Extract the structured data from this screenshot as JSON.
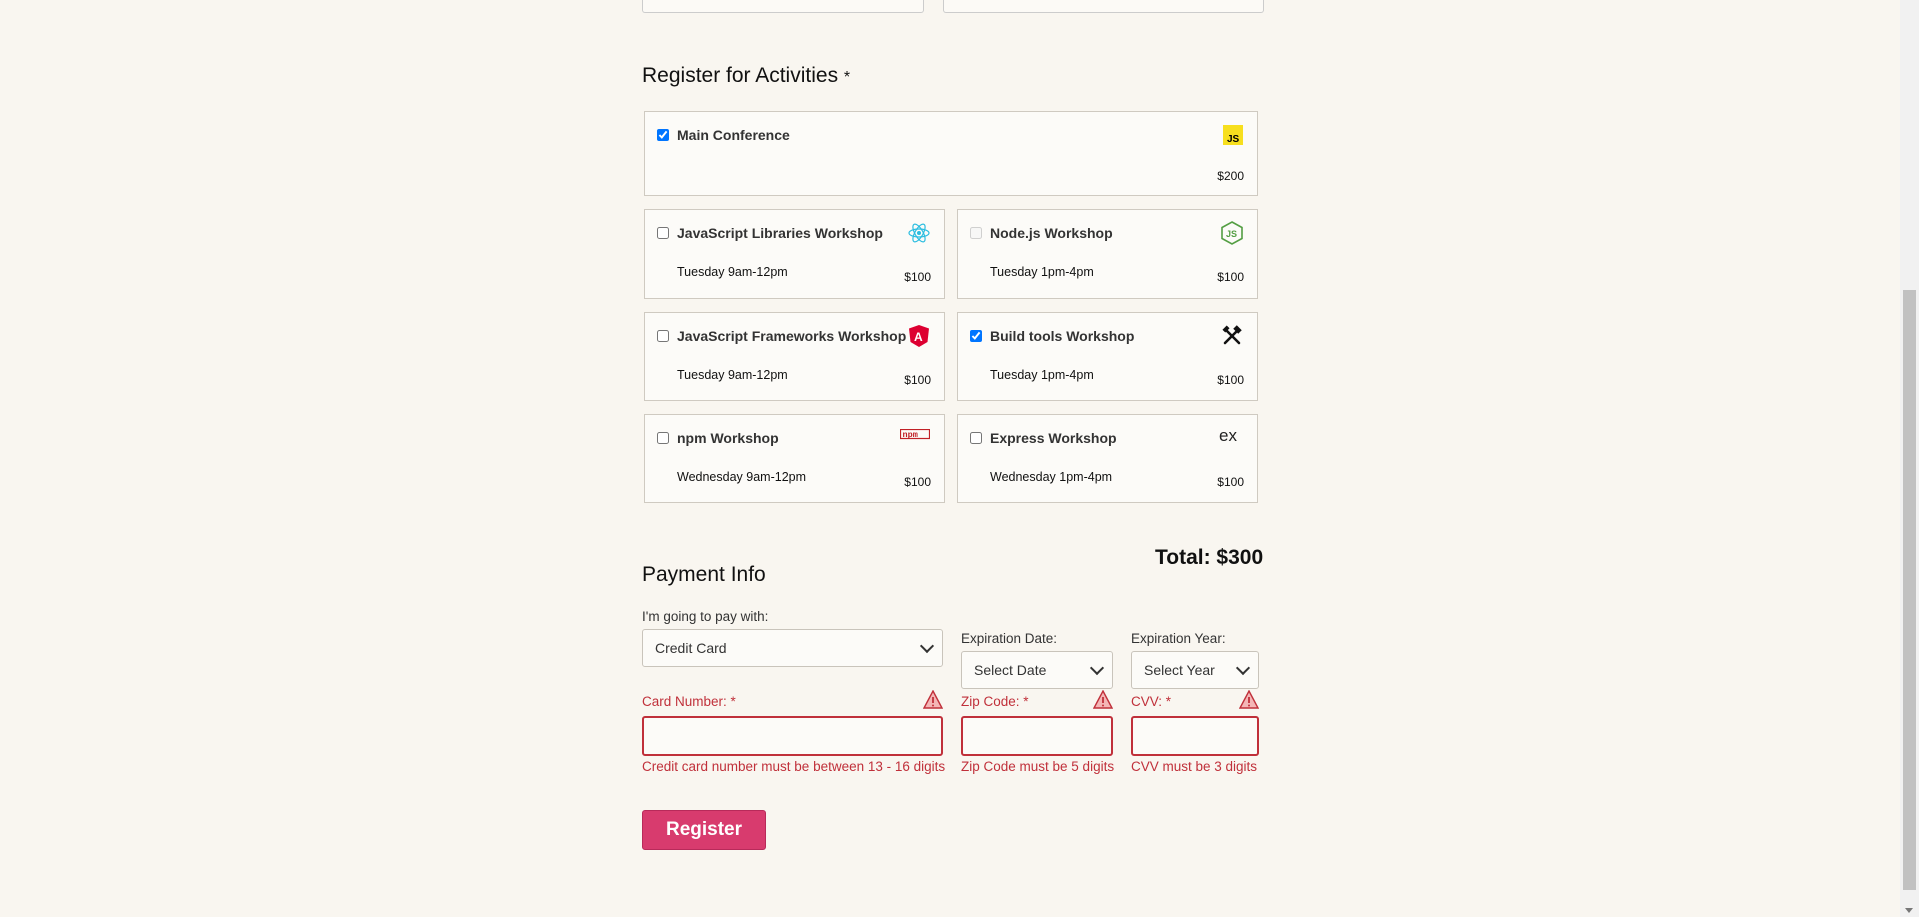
{
  "activities": {
    "heading": "Register for Activities",
    "required_mark": "*",
    "main": {
      "title": "Main Conference",
      "price": "$200",
      "checked": true,
      "logo": "js-logo-icon"
    },
    "workshops": [
      {
        "title": "JavaScript Libraries Workshop",
        "time": "Tuesday 9am-12pm",
        "price": "$100",
        "checked": false,
        "logo": "react-icon"
      },
      {
        "title": "Node.js Workshop",
        "time": "Tuesday 1pm-4pm",
        "price": "$100",
        "checked": false,
        "disabled": true,
        "logo": "nodejs-icon"
      },
      {
        "title": "JavaScript Frameworks Workshop",
        "time": "Tuesday 9am-12pm",
        "price": "$100",
        "checked": false,
        "logo": "angular-icon"
      },
      {
        "title": "Build tools Workshop",
        "time": "Tuesday 1pm-4pm",
        "price": "$100",
        "checked": true,
        "logo": "tools-icon"
      },
      {
        "title": "npm Workshop",
        "time": "Wednesday 9am-12pm",
        "price": "$100",
        "checked": false,
        "logo": "npm-icon"
      },
      {
        "title": "Express Workshop",
        "time": "Wednesday 1pm-4pm",
        "price": "$100",
        "checked": false,
        "logo": "express-icon"
      }
    ],
    "total": "Total: $300"
  },
  "payment": {
    "heading": "Payment Info",
    "pay_with_label": "I'm going to pay with:",
    "pay_with_value": "Credit Card",
    "exp_date_label": "Expiration Date:",
    "exp_date_value": "Select Date",
    "exp_year_label": "Expiration Year:",
    "exp_year_value": "Select Year",
    "card_label": "Card Number:",
    "zip_label": "Zip Code:",
    "cvv_label": "CVV:",
    "required_mark": "*",
    "card_error": "Credit card number must be between 13 - 16 digits",
    "zip_error": "Zip Code must be 5 digits",
    "cvv_error": "CVV must be 3 digits",
    "register_label": "Register"
  },
  "colors": {
    "background": "#f9f6f0",
    "error": "#c0303a",
    "register_button": "#d83b6e",
    "checkbox_checked": "#1a73e8"
  }
}
